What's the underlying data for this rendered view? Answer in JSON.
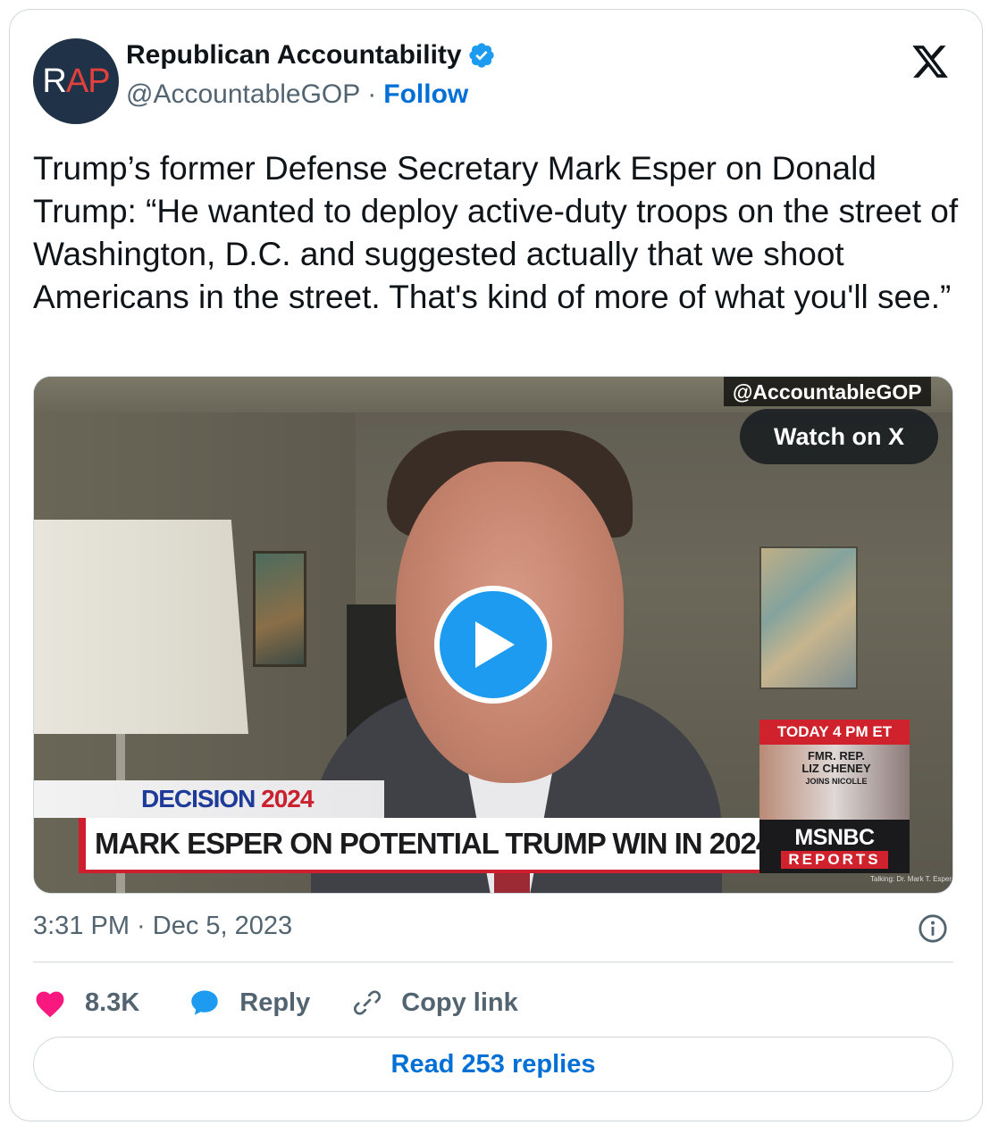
{
  "author": {
    "avatar_text_r": "R",
    "avatar_text_ap": "AP",
    "display_name": "Republican Accountability",
    "handle": "@AccountableGOP",
    "separator": "·",
    "follow_label": "Follow",
    "verified": true
  },
  "tweet": {
    "text": "Trump’s former Defense Secretary Mark Esper on Donald Trump: “He wanted to deploy active-duty troops on the street of Washington, D.C. and suggested actually that we shoot Americans in the street. That's kind of more of what you'll see.”",
    "timestamp": "3:31 PM · Dec 5, 2023"
  },
  "media": {
    "watermark": "@AccountableGOP",
    "watch_label": "Watch on X",
    "decision_label": "DECISION",
    "decision_year": "2024",
    "headline": "MARK ESPER ON POTENTIAL TRUMP WIN IN 2024",
    "promo_time": "TODAY 4 PM ET",
    "promo_line1": "FMR. REP.",
    "promo_line2": "LIZ CHENEY",
    "promo_line3": "JOINS NICOLLE",
    "network": "MSNBC",
    "network_sub": "REPORTS",
    "talking_credit": "Talking: Dr. Mark T. Esper"
  },
  "actions": {
    "like_count": "8.3K",
    "reply_label": "Reply",
    "copy_label": "Copy link",
    "read_replies_label": "Read 253 replies"
  },
  "colors": {
    "accent": "#006fd6",
    "verified": "#1d9bf0",
    "like": "#f91880",
    "play": "#1d9bf0",
    "msnbc_red": "#d0222c"
  },
  "icons": [
    "verified-badge-icon",
    "x-logo-icon",
    "play-icon",
    "info-icon",
    "heart-icon",
    "reply-bubble-icon",
    "link-icon"
  ]
}
